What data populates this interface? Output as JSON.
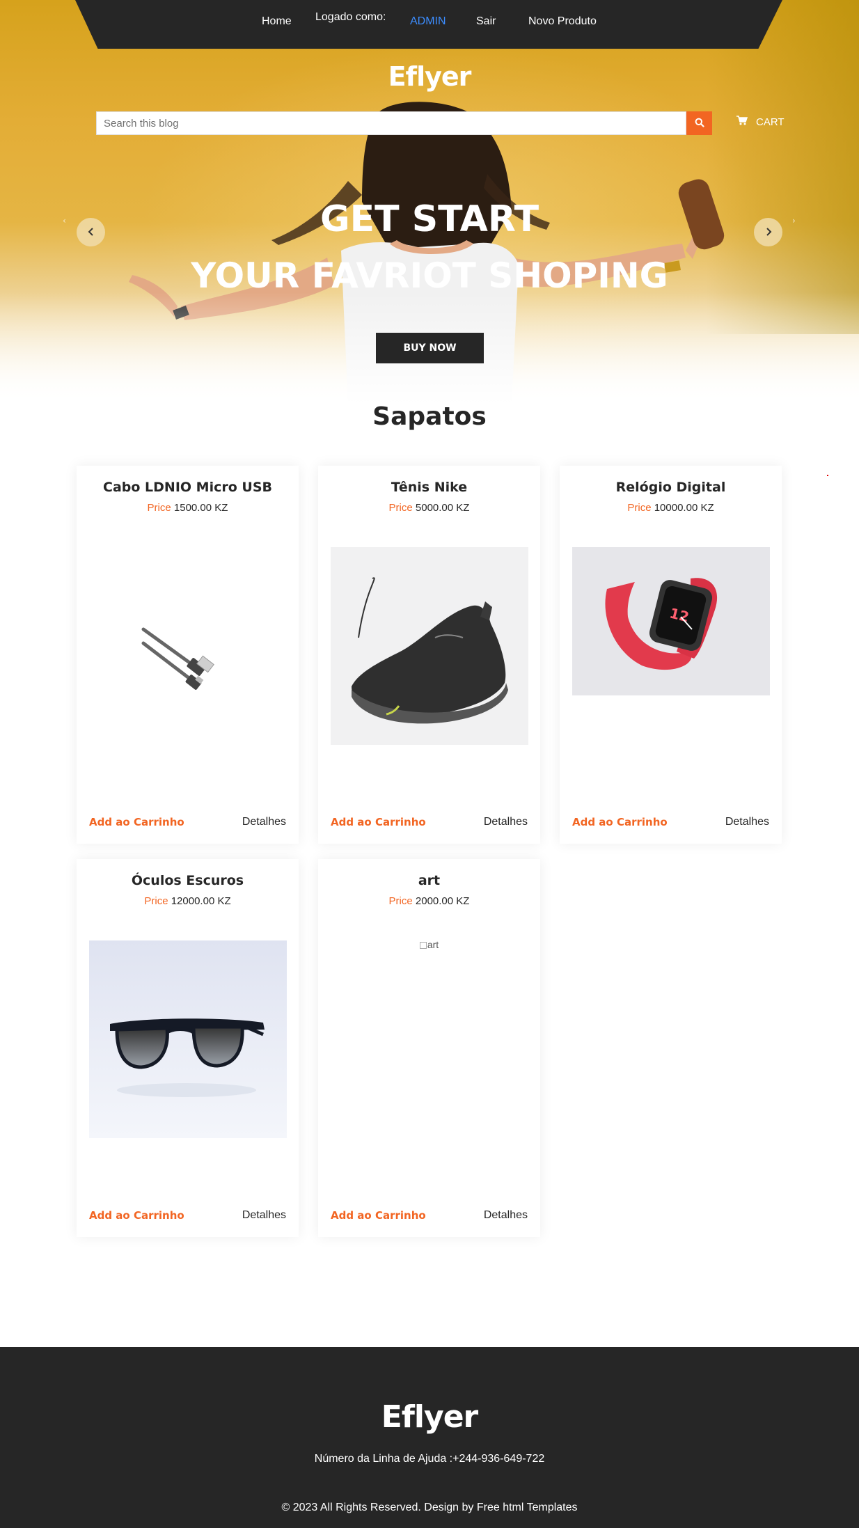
{
  "nav": {
    "home": "Home",
    "logged_as": "Logado como:",
    "user": "ADMIN",
    "logout": "Sair",
    "new_product": "Novo Produto"
  },
  "brand": "Eflyer",
  "search": {
    "placeholder": "Search this blog",
    "icon": "search-icon"
  },
  "cart": {
    "label": "CART",
    "icon": "shopping-cart-icon"
  },
  "hero": {
    "line1": "GET START",
    "line2": "YOUR FAVRIOT SHOPING",
    "button": "BUY NOW",
    "prev_icon": "chevron-left-icon",
    "next_icon": "chevron-right-icon"
  },
  "section_title": "Sapatos",
  "products": [
    {
      "name": "Cabo LDNIO Micro USB",
      "price_label": "Price",
      "price": "1500.00 KZ",
      "image": "usb-cable",
      "add": "Add ao Carrinho",
      "details": "Detalhes"
    },
    {
      "name": "Tênis Nike",
      "price_label": "Price",
      "price": "5000.00 KZ",
      "image": "sneaker",
      "add": "Add ao Carrinho",
      "details": "Detalhes"
    },
    {
      "name": "Relógio Digital",
      "price_label": "Price",
      "price": "10000.00 KZ",
      "image": "smartwatch",
      "add": "Add ao Carrinho",
      "details": "Detalhes"
    },
    {
      "name": "Óculos Escuros",
      "price_label": "Price",
      "price": "12000.00 KZ",
      "image": "sunglasses",
      "add": "Add ao Carrinho",
      "details": "Detalhes"
    },
    {
      "name": "art",
      "price_label": "Price",
      "price": "2000.00 KZ",
      "image_alt": "art",
      "add": "Add ao Carrinho",
      "details": "Detalhes"
    }
  ],
  "footer": {
    "brand": "Eflyer",
    "helpline": "Número da Linha de Ajuda :+244-936-649-722",
    "copyright": "© 2023 All Rights Reserved. Design by Free html Templates"
  },
  "colors": {
    "accent": "#f26522",
    "dark": "#262626",
    "user_link": "#3c8dff",
    "hero_yellow": "#e3ad36"
  }
}
